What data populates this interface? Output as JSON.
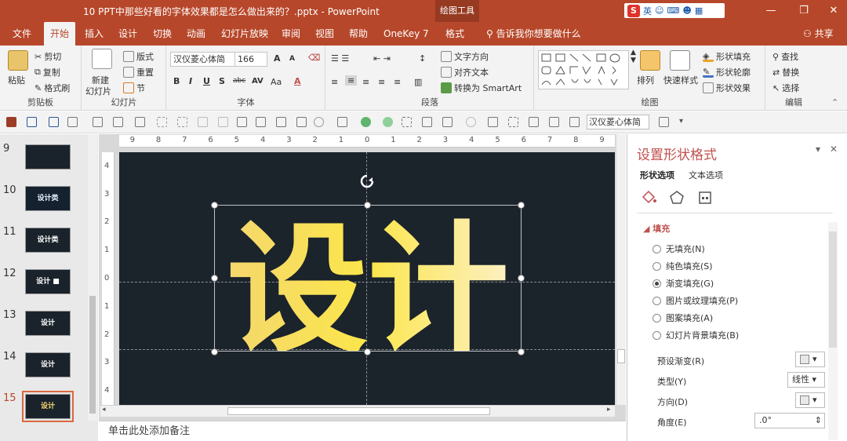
{
  "window": {
    "title": "10 PPT中那些好看的字体效果都是怎么做出来的？.pptx  -  PowerPoint",
    "context_tab_group": "绘图工具",
    "ime": {
      "logo": "S",
      "lang": "英"
    },
    "controls": {
      "minimize": "—",
      "restore": "❐",
      "close": "✕"
    }
  },
  "ribbon_tabs": [
    "文件",
    "开始",
    "插入",
    "设计",
    "切换",
    "动画",
    "幻灯片放映",
    "审阅",
    "视图",
    "帮助",
    "OneKey 7",
    "格式"
  ],
  "active_tab": "开始",
  "tell_me": "告诉我你想要做什么",
  "share": "共享",
  "ribbon": {
    "clipboard": {
      "label": "剪贴板",
      "paste": "粘贴",
      "cut": "剪切",
      "copy": "复制",
      "format_painter": "格式刷"
    },
    "slides": {
      "label": "幻灯片",
      "new_slide": "新建",
      "new_slide2": "幻灯片",
      "layout": "版式",
      "reset": "重置",
      "section": "节"
    },
    "font": {
      "label": "字体",
      "font_name": "汉仪菱心体简",
      "font_size": "166",
      "bold": "B",
      "italic": "I",
      "underline": "U",
      "shadow": "S",
      "strike": "abc",
      "spacing": "AV",
      "case": "Aa",
      "grow": "A",
      "shrink": "A",
      "color": "A"
    },
    "paragraph": {
      "label": "段落",
      "text_direction": "文字方向",
      "align_text": "对齐文本",
      "smartart": "转换为 SmartArt"
    },
    "drawing": {
      "label": "绘图",
      "arrange": "排列",
      "quick_styles": "快速样式",
      "shape_fill": "形状填充",
      "shape_outline": "形状轮廓",
      "shape_effects": "形状效果"
    },
    "editing": {
      "label": "编辑",
      "find": "查找",
      "replace": "替换",
      "select": "选择"
    }
  },
  "qat": {
    "font_name": "汉仪菱心体简"
  },
  "slides": [
    {
      "num": "9",
      "text": ""
    },
    {
      "num": "10",
      "text": "设计类"
    },
    {
      "num": "11",
      "text": "设计类"
    },
    {
      "num": "12",
      "text": "设计 ■"
    },
    {
      "num": "13",
      "text": "设计"
    },
    {
      "num": "14",
      "text": "设计"
    },
    {
      "num": "15",
      "text": "设计"
    }
  ],
  "active_slide": "15",
  "hruler": [
    "9",
    "8",
    "7",
    "6",
    "5",
    "4",
    "3",
    "2",
    "1",
    "0",
    "1",
    "2",
    "3",
    "4",
    "5",
    "6",
    "7",
    "8",
    "9"
  ],
  "vruler": [
    "4",
    "3",
    "2",
    "1",
    "0",
    "1",
    "2",
    "3",
    "4"
  ],
  "slide": {
    "main_text": "设计",
    "gradient": [
      "#f5d76e",
      "#fbe64a",
      "#fdf0c2"
    ],
    "background": "#1b232b"
  },
  "notes_placeholder": "单击此处添加备注",
  "format_pane": {
    "title": "设置形状格式",
    "tabs": [
      "形状选项",
      "文本选项"
    ],
    "section": "填充",
    "fill_options": [
      {
        "label": "无填充(N)",
        "selected": false
      },
      {
        "label": "纯色填充(S)",
        "selected": false
      },
      {
        "label": "渐变填充(G)",
        "selected": true
      },
      {
        "label": "图片或纹理填充(P)",
        "selected": false
      },
      {
        "label": "图案填充(A)",
        "selected": false
      },
      {
        "label": "幻灯片背景填充(B)",
        "selected": false
      }
    ],
    "props": {
      "preset": "预设渐变(R)",
      "type": "类型(Y)",
      "type_value": "线性",
      "direction": "方向(D)",
      "angle": "角度(E)",
      "angle_value": ".0°"
    }
  }
}
